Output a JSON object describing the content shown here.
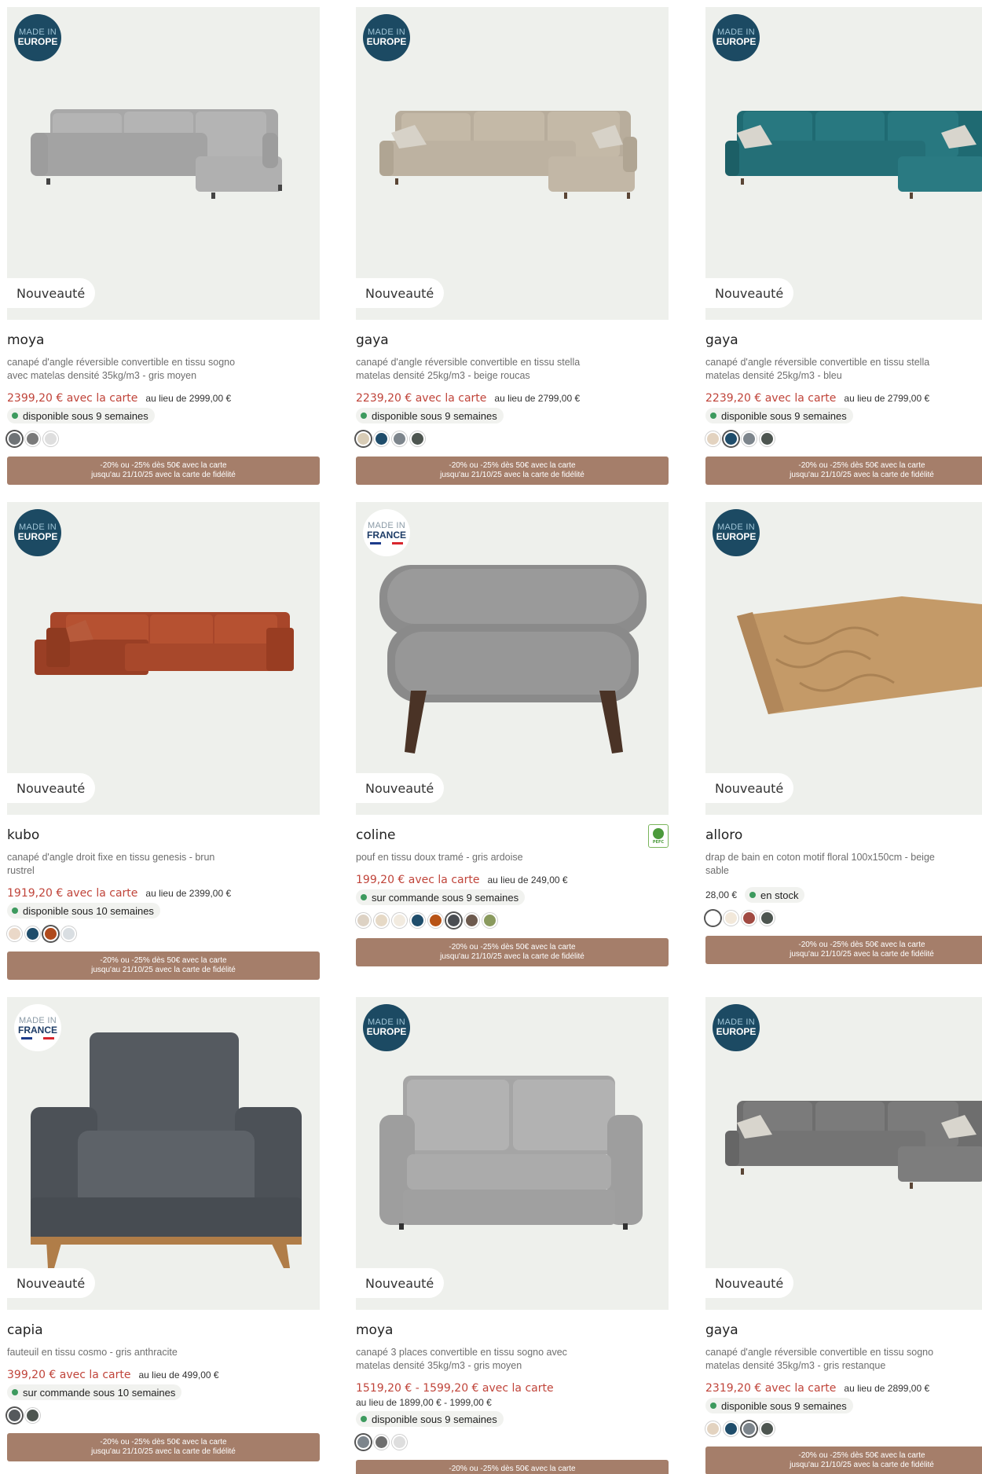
{
  "badges": {
    "made_in": "MADE IN",
    "europe": "EUROPE",
    "france": "FRANCE",
    "new": "Nouveauté"
  },
  "promo": {
    "line1": "-20% ou -25% dès 50€ avec la carte",
    "line2": "jusqu'au 21/10/25 avec la carte de fidélité"
  },
  "colors": {
    "accent_price": "#c0443a",
    "promo_bg": "#a57e6a",
    "availability_dot": "#3d9a5e",
    "badge_europe": "#1c4a63"
  },
  "products": [
    {
      "name": "moya",
      "desc": "canapé d'angle réversible convertible en tissu sogno avec matelas densité 35kg/m3 - gris moyen",
      "price": "2399,20 € avec la carte",
      "old": "au lieu de 2999,00 €",
      "availability": "disponible sous 9 semaines",
      "origin": "EUROPE",
      "swatches": [
        "#6f7376",
        "#7a7a7a",
        "#dedede"
      ]
    },
    {
      "name": "gaya",
      "desc": "canapé d'angle réversible convertible en tissu stella matelas densité 25kg/m3 - beige roucas",
      "price": "2239,20 € avec la carte",
      "old": "au lieu de 2799,00 €",
      "availability": "disponible sous 9 semaines",
      "origin": "EUROPE",
      "swatches": [
        "#d8ccb6",
        "#1f4d6b",
        "#7d858c",
        "#4d5550"
      ]
    },
    {
      "name": "gaya",
      "desc": "canapé d'angle réversible convertible en tissu stella matelas densité 25kg/m3 - bleu",
      "price": "2239,20 € avec la carte",
      "old": "au lieu de 2799,00 €",
      "availability": "disponible sous 9 semaines",
      "origin": "EUROPE",
      "swatches": [
        "#e3d3c0",
        "#1f4d6b",
        "#7d858c",
        "#4d5550"
      ]
    },
    {
      "name": "kubo",
      "desc": "canapé d'angle droit fixe en tissu genesis - brun rustrel",
      "price": "1919,20 € avec la carte",
      "old": "au lieu de 2399,00 €",
      "availability": "disponible sous 10 semaines",
      "origin": "EUROPE",
      "swatches": [
        "#ead8c8",
        "#1f4d6b",
        "#b04a1c",
        "#d9dee2"
      ]
    },
    {
      "name": "coline",
      "desc": "pouf en tissu doux tramé - gris ardoise",
      "price": "199,20 € avec la carte",
      "old": "au lieu de 249,00 €",
      "availability": "sur commande sous 9 semaines",
      "origin": "FRANCE",
      "swatches": [
        "#ddd2c4",
        "#e6d9c6",
        "#f2ebe0",
        "#1f4d6b",
        "#b85316",
        "#4a4d52",
        "#6d5a4e",
        "#8a9a5e"
      ]
    },
    {
      "name": "alloro",
      "desc": "drap de bain en coton motif floral 100x150cm - beige sable",
      "price": "28,00 €",
      "availability": "en stock",
      "origin": "EUROPE",
      "swatches": [
        "#ffffff",
        "#f2e8da",
        "#a14a42",
        "#4d5550"
      ]
    },
    {
      "name": "capia",
      "desc": "fauteuil en tissu cosmo - gris anthracite",
      "price": "399,20 € avec la carte",
      "old": "au lieu de 499,00 €",
      "availability": "sur commande sous 10 semaines",
      "origin": "FRANCE",
      "swatches": [
        "#55595c",
        "#4d5550"
      ]
    },
    {
      "name": "moya",
      "desc": "canapé 3 places convertible en tissu sogno avec matelas densité 35kg/m3 - gris moyen",
      "price": "1519,20 € - 1599,20 € avec la carte",
      "old": "au lieu de 1899,00 € - 1999,00 €",
      "availability": "disponible sous 9 semaines",
      "origin": "EUROPE",
      "swatches": [
        "#7d858c",
        "#6f6f6f",
        "#dedede"
      ]
    },
    {
      "name": "gaya",
      "desc": "canapé d'angle réversible convertible en tissu sogno matelas densité 35kg/m3 - gris restanque",
      "price": "2319,20 € avec la carte",
      "old": "au lieu de 2899,00 €",
      "availability": "disponible sous 9 semaines",
      "origin": "EUROPE",
      "swatches": [
        "#e3d3c0",
        "#1f4d6b",
        "#7d858c",
        "#4d5550"
      ]
    }
  ]
}
